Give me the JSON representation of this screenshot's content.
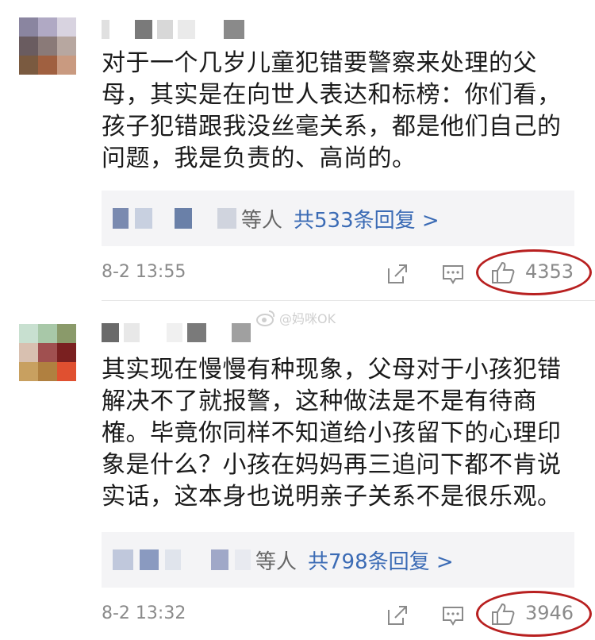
{
  "watermark": {
    "text": "@妈咪OK"
  },
  "comments": [
    {
      "text_lines": [
        "对于一个几岁儿童犯错要警察来处理的父",
        "母，其实是在向世人表达和标榜：你们看，",
        "孩子犯错跟我没丝毫关系，都是他们自己的",
        "问题，我是负责的、高尚的。"
      ],
      "replies_suffix": "等人",
      "reply_count_label": "共533条回复 >",
      "time": "8-2 13:55",
      "likes": "4353",
      "avatar_colors": [
        "#8a85a0",
        "#b0a9c4",
        "#d8d3e0",
        "#6a5c60",
        "#8a7a78",
        "#b7a7a0",
        "#7a5a40",
        "#a06040",
        "#c99a80"
      ]
    },
    {
      "text_lines": [
        "其实现在慢慢有种现象，父母对于小孩犯错",
        "解决不了就报警，这种做法是不是有待商",
        "榷。毕竟你同样不知道给小孩留下的心理印",
        "象是什么？小孩在妈妈再三追问下都不肯说",
        "实话，这本身也说明亲子关系不是很乐观。"
      ],
      "replies_suffix": "等人",
      "reply_count_label": "共798条回复 >",
      "time": "8-2 13:32",
      "likes": "3946",
      "avatar_colors": [
        "#c8e0d0",
        "#a8c8a8",
        "#8a9a6a",
        "#d8c0b0",
        "#a05050",
        "#7a2020",
        "#c8a060",
        "#b08040",
        "#e05030"
      ]
    }
  ],
  "icons": {
    "share": "share-icon",
    "comment": "comment-icon",
    "like": "thumbs-up-icon"
  },
  "colors": {
    "link": "#3b6bb5",
    "highlight_circle": "#b82020",
    "meta_text": "#8a8a8a",
    "reply_bg": "#f4f4f6"
  }
}
